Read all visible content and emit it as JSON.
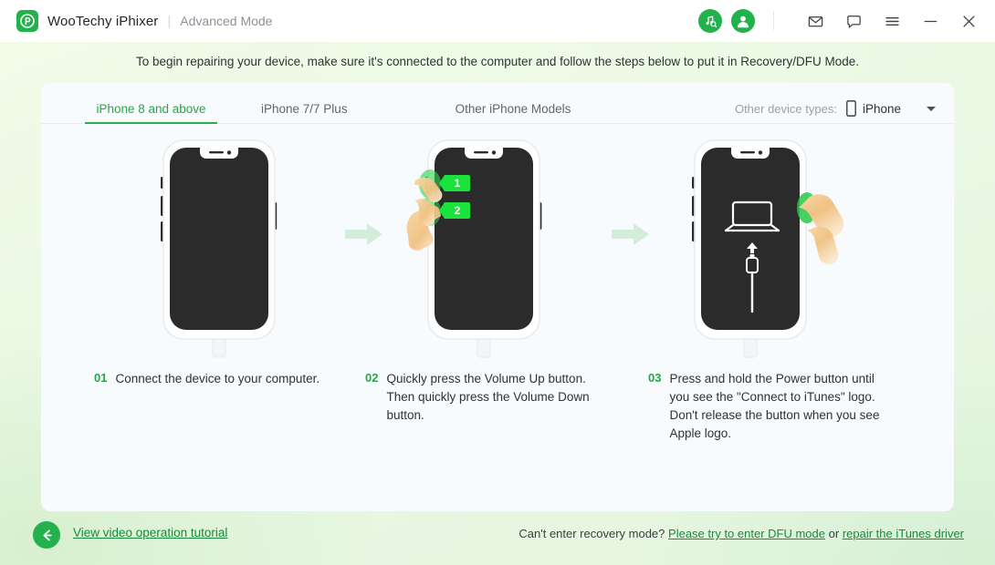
{
  "titlebar": {
    "logo_icon": "p-logo-icon",
    "brand_name": "WooTechy iPhixer",
    "separator": "|",
    "mode_label": "Advanced Mode",
    "icons": [
      {
        "name": "itunes-search-icon",
        "kind": "circle-green"
      },
      {
        "name": "user-account-icon",
        "kind": "circle-green"
      },
      {
        "name": "mail-icon",
        "kind": "outline"
      },
      {
        "name": "feedback-chat-icon",
        "kind": "outline"
      },
      {
        "name": "menu-hamburger-icon",
        "kind": "outline"
      },
      {
        "name": "minimize-icon",
        "kind": "outline"
      },
      {
        "name": "close-icon",
        "kind": "outline"
      }
    ]
  },
  "notice": "To begin repairing your device, make sure it's connected to the computer and follow the steps below to put it in Recovery/DFU Mode.",
  "tabs": [
    {
      "label": "iPhone 8 and above",
      "active": true
    },
    {
      "label": "iPhone 7/7 Plus",
      "active": false
    },
    {
      "label": "Other iPhone Models",
      "active": false
    }
  ],
  "device_select": {
    "label": "Other device types:",
    "icon": "phone-icon",
    "value": "iPhone",
    "caret": "chevron-down-icon"
  },
  "steps": [
    {
      "number": "01",
      "text": "Connect the device to your computer.",
      "illustration": "iphone-connected-to-computer"
    },
    {
      "number": "02",
      "text": "Quickly press the Volume Up button. Then quickly press the Volume Down button.",
      "illustration": "iphone-volume-buttons-hand",
      "badges": [
        "1",
        "2"
      ]
    },
    {
      "number": "03",
      "text": "Press and hold the Power button until you see the \"Connect to iTunes\" logo. Don't release the button when you see Apple logo.",
      "illustration": "iphone-connect-to-itunes-screen"
    }
  ],
  "footer": {
    "back_icon": "back-arrow-icon",
    "tutorial_link": "View video operation tutorial",
    "help_prefix": "Can't enter recovery mode?",
    "help_link_1": "Please try to enter DFU mode",
    "help_middle": "or",
    "help_link_2": "repair the iTunes driver"
  },
  "colors": {
    "brand_green": "#22b24c",
    "accent_green": "#27a745",
    "link_green": "#188a3a",
    "page_bg": "#eaf8e4",
    "card_bg": "#f7fbfe",
    "screen_dark": "#2b2b2b"
  }
}
